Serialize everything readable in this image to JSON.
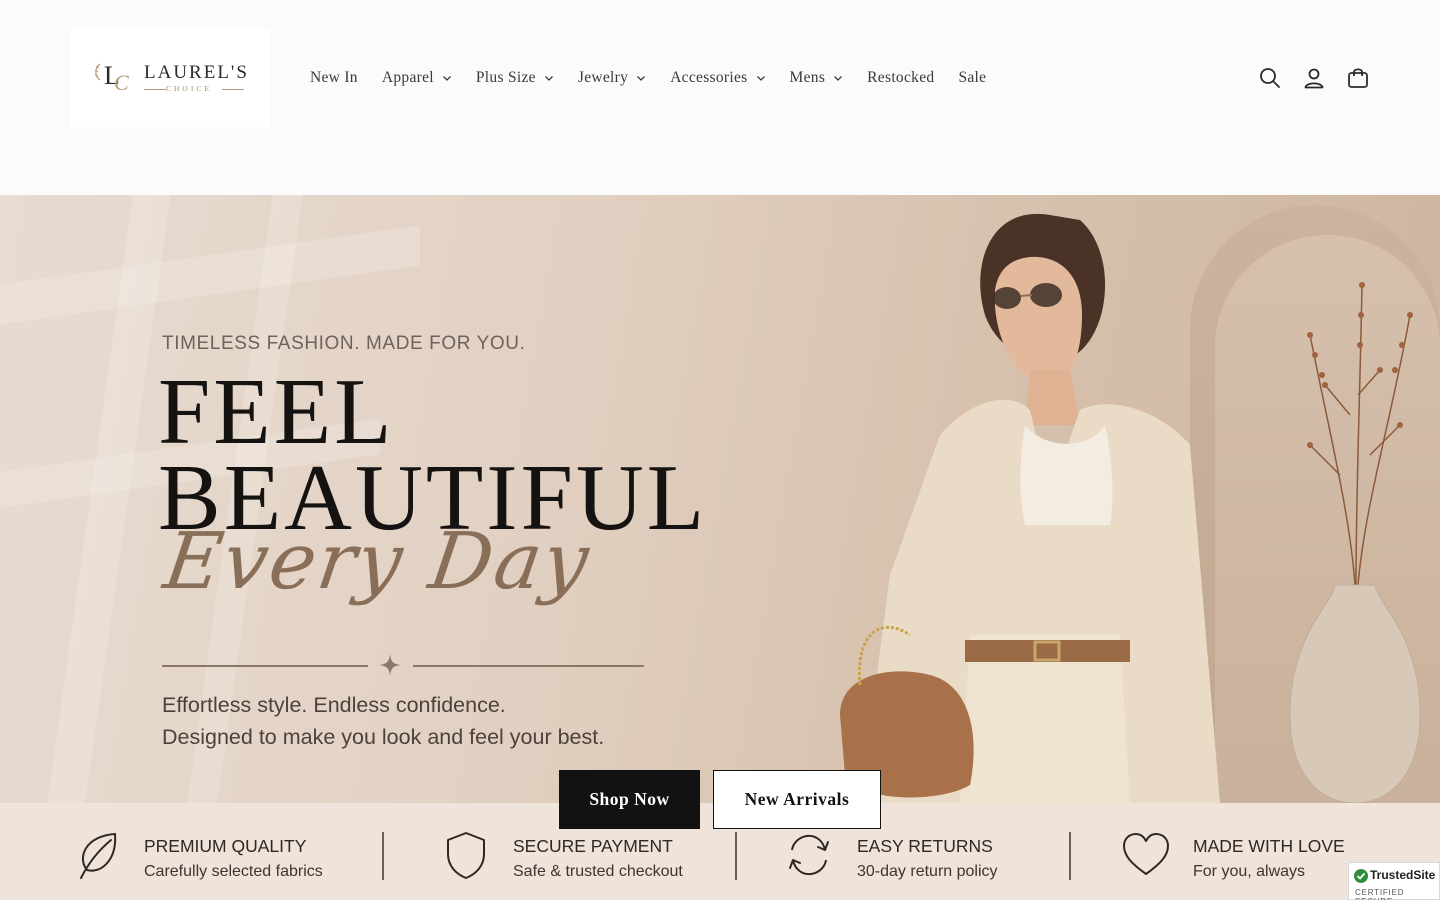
{
  "brand": {
    "logo_initials": "LC",
    "name": "LAUREL'S",
    "sub": "CHOICE"
  },
  "nav": {
    "items": [
      {
        "label": "New In",
        "has_dropdown": false
      },
      {
        "label": "Apparel",
        "has_dropdown": true
      },
      {
        "label": "Plus Size",
        "has_dropdown": true
      },
      {
        "label": "Jewelry",
        "has_dropdown": true
      },
      {
        "label": "Accessories",
        "has_dropdown": true
      },
      {
        "label": "Mens",
        "has_dropdown": true
      },
      {
        "label": "Restocked",
        "has_dropdown": false
      },
      {
        "label": "Sale",
        "has_dropdown": false
      }
    ]
  },
  "header_icons": [
    "search-icon",
    "account-icon",
    "cart-icon"
  ],
  "hero": {
    "eyebrow": "TIMELESS FASHION. MADE FOR YOU.",
    "headline_1": "FEEL",
    "headline_2": "BEAUTIFUL",
    "headline_script": "Every Day",
    "tagline_1": "Effortless style. Endless confidence.",
    "tagline_2": "Designed to make you look and feel your best.",
    "cta_primary": "Shop Now",
    "cta_secondary": "New Arrivals"
  },
  "features": [
    {
      "icon": "leaf-icon",
      "title": "PREMIUM QUALITY",
      "subtitle": "Carefully selected fabrics"
    },
    {
      "icon": "shield-icon",
      "title": "SECURE PAYMENT",
      "subtitle": "Safe & trusted checkout"
    },
    {
      "icon": "returns-icon",
      "title": "EASY RETURNS",
      "subtitle": "30-day return policy"
    },
    {
      "icon": "heart-icon",
      "title": "MADE WITH LOVE",
      "subtitle": "For you, always"
    }
  ],
  "trust_badge": {
    "name": "TrustedSite",
    "sub": "CERTIFIED SECURE"
  },
  "colors": {
    "accent_dark": "#121212",
    "hero_bg": "#e2d2c4",
    "script_brown": "#8a6f58",
    "feature_strip": "#efe3da"
  }
}
